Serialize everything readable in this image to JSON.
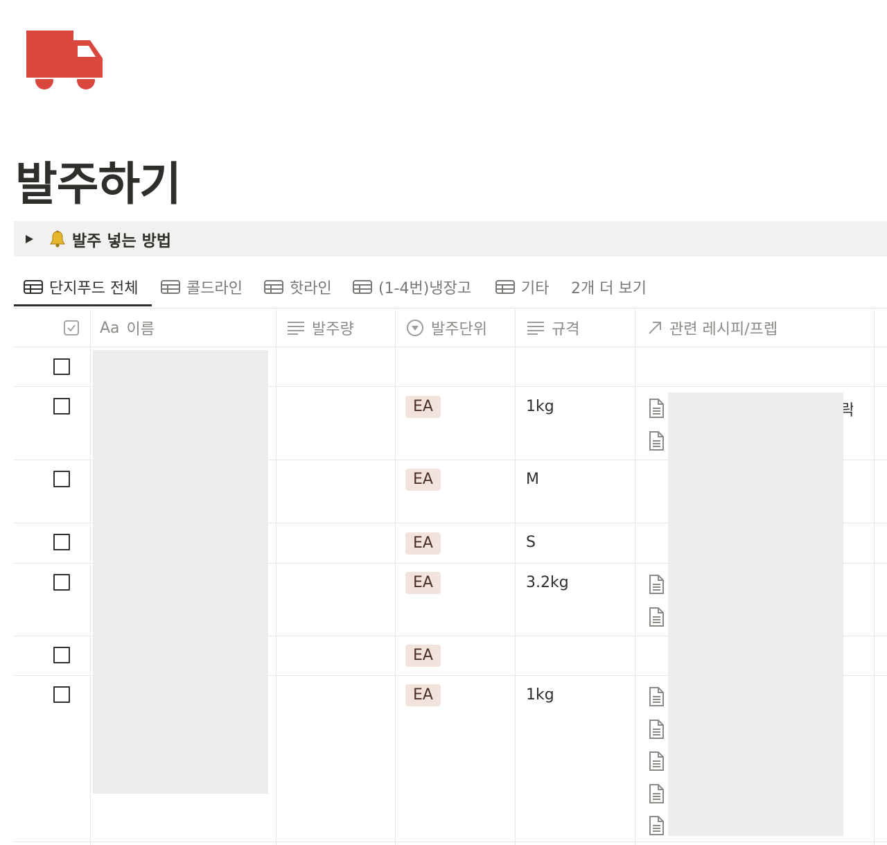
{
  "page": {
    "title": "발주하기",
    "icon": "truck-icon",
    "icon_color": "#d9473f"
  },
  "callout": {
    "icon": "bell-icon",
    "text": "발주 넣는 방법"
  },
  "tabs": [
    {
      "label": "단지푸드 전체",
      "icon": "table-icon",
      "active": true
    },
    {
      "label": "콜드라인",
      "icon": "table-icon",
      "active": false
    },
    {
      "label": "핫라인",
      "icon": "table-icon",
      "active": false
    },
    {
      "label": "(1-4번)냉장고",
      "icon": "table-icon",
      "active": false
    },
    {
      "label": "기타",
      "icon": "table-icon",
      "active": false
    },
    {
      "label": "2개 더 보기",
      "icon": "",
      "active": false
    }
  ],
  "columns": {
    "check": {
      "icon": "checkbox-icon"
    },
    "name": {
      "prefix": "Aa",
      "label": "이름"
    },
    "quantity": {
      "label": "발주량",
      "icon": "text-lines-icon"
    },
    "unit": {
      "label": "발주단위",
      "icon": "select-icon"
    },
    "spec": {
      "label": "규격",
      "icon": "text-lines-icon"
    },
    "related": {
      "label": "관련 레시피/프렙",
      "icon": "arrow-up-right-icon"
    }
  },
  "rows": [
    {
      "unit": "",
      "spec": "",
      "docs": 0
    },
    {
      "unit": "EA",
      "spec": "1kg",
      "docs": 2
    },
    {
      "unit": "EA",
      "spec": "M",
      "docs": 0
    },
    {
      "unit": "EA",
      "spec": "S",
      "docs": 0
    },
    {
      "unit": "EA",
      "spec": "3.2kg",
      "docs": 2
    },
    {
      "unit": "EA",
      "spec": "",
      "docs": 0
    },
    {
      "unit": "EA",
      "spec": "1kg",
      "docs": 5
    }
  ],
  "related_overflow_char": "락",
  "colors": {
    "tag_bg": "#f3e3dd",
    "tag_text": "#4a2f26",
    "redaction": "#ececec"
  }
}
